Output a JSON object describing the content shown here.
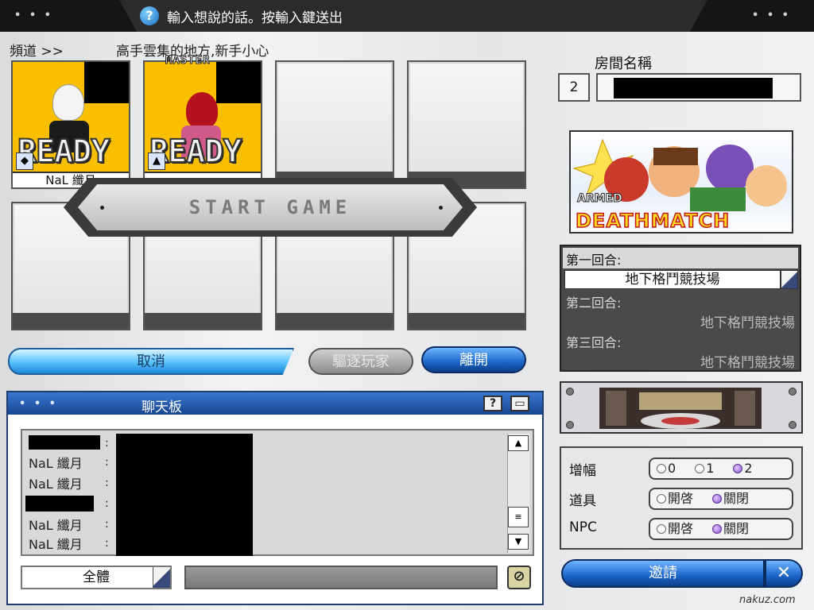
{
  "top_bar": {
    "help_icon": "question-icon",
    "hint": "輸入想說的話。按輸入鍵送出"
  },
  "channel": {
    "label": "頻道 >>",
    "description": "高手雲集的地方,新手小心"
  },
  "slots": [
    {
      "state": "READY",
      "name": "NaL 纖月",
      "master": false
    },
    {
      "state": "READY",
      "name": "",
      "master": true,
      "master_label": "MASTER"
    }
  ],
  "start_game_label": "START GAME",
  "buttons": {
    "cancel": "取消",
    "kick": "驅逐玩家",
    "leave": "離開",
    "invite": "邀請",
    "close": "✕"
  },
  "chat": {
    "title": "聊天板",
    "lines": [
      "",
      "NaL 纖月",
      "NaL 纖月",
      "",
      "NaL 纖月",
      "NaL 纖月"
    ],
    "colon": ":",
    "target_select": "全體"
  },
  "room": {
    "label": "房間名稱",
    "number": "2"
  },
  "mode_banner": {
    "sub": "ARMED",
    "title": "DEATHMATCH"
  },
  "rounds": [
    {
      "label": "第一回合:",
      "value": "地下格鬥競技場"
    },
    {
      "label": "第二回合:",
      "value": "地下格鬥競技場"
    },
    {
      "label": "第三回合:",
      "value": "地下格鬥競技場"
    }
  ],
  "options": {
    "boost": {
      "label": "增幅",
      "choices": [
        "0",
        "1",
        "2"
      ],
      "selected": "2"
    },
    "items": {
      "label": "道具",
      "choices": [
        "開啓",
        "關閉"
      ],
      "selected": "關閉"
    },
    "npc": {
      "label": "NPC",
      "choices": [
        "開啓",
        "關閉"
      ],
      "selected": "關閉"
    }
  },
  "watermark": "nakuz.com"
}
